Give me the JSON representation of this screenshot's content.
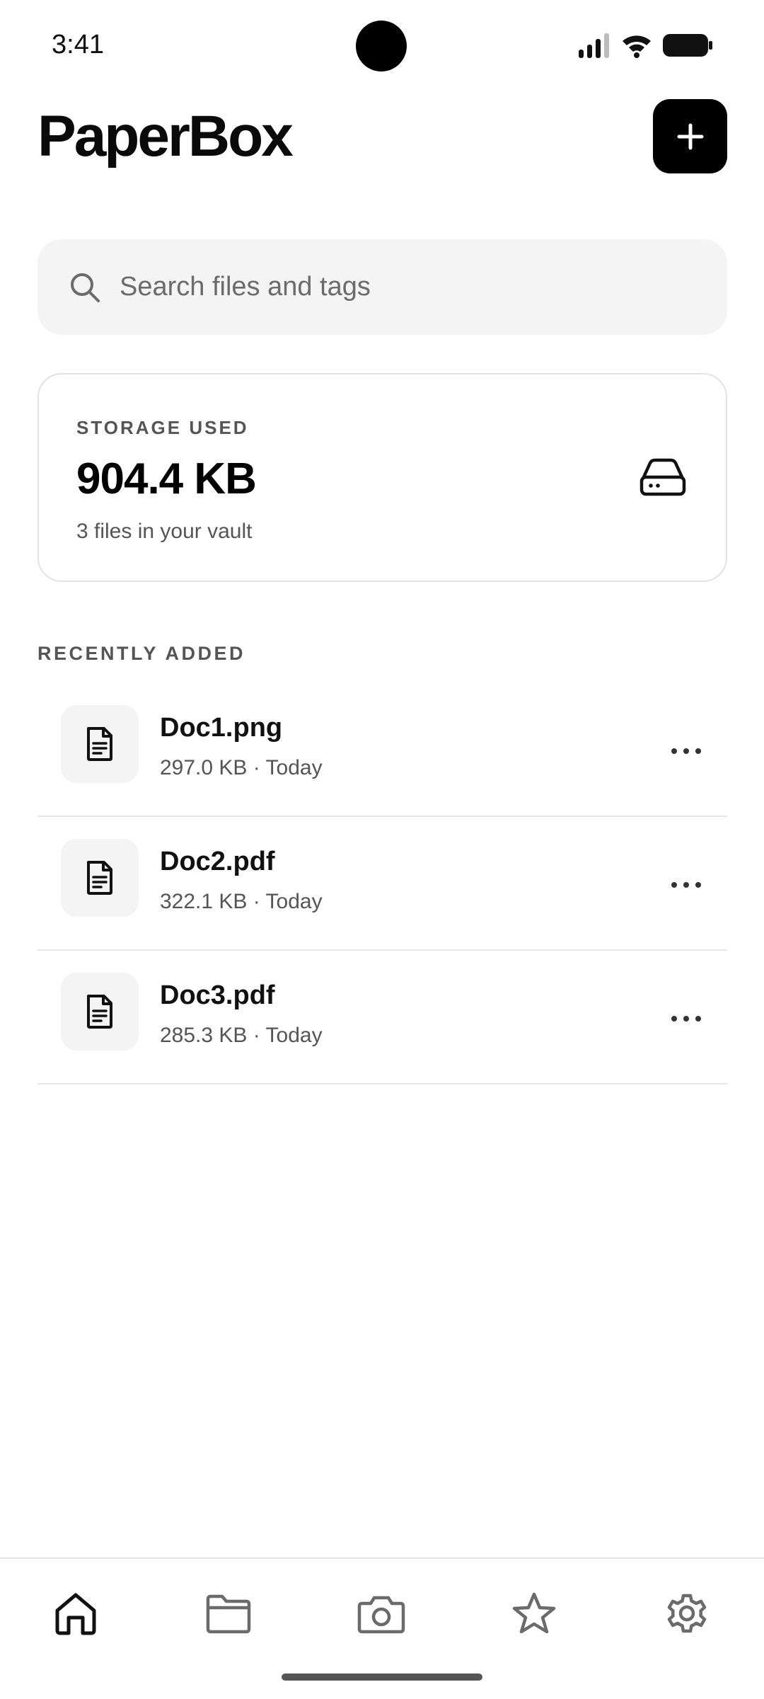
{
  "status_bar": {
    "time": "3:41",
    "icons": [
      "signal-icon",
      "wifi-icon",
      "battery-icon"
    ]
  },
  "header": {
    "title": "PaperBox",
    "add_icon": "plus-icon"
  },
  "search": {
    "placeholder": "Search files and tags",
    "value": "",
    "icon": "search-icon"
  },
  "storage": {
    "label": "STORAGE USED",
    "value": "904.4 KB",
    "subtitle": "3 files in your vault",
    "icon": "drive-icon"
  },
  "recent": {
    "title": "RECENTLY ADDED",
    "files": [
      {
        "name": "Doc1.png",
        "meta": "297.0 KB · Today"
      },
      {
        "name": "Doc2.pdf",
        "meta": "322.1 KB · Today"
      },
      {
        "name": "Doc3.pdf",
        "meta": "285.3 KB · Today"
      }
    ]
  },
  "bottom_nav": {
    "items": [
      "home-icon",
      "folder-icon",
      "camera-icon",
      "star-icon",
      "gear-icon"
    ],
    "active": "home-icon"
  },
  "colors": {
    "accent": "#000000",
    "surface": "#f4f4f4",
    "border": "#e3e3e3",
    "muted_text": "#555555"
  }
}
